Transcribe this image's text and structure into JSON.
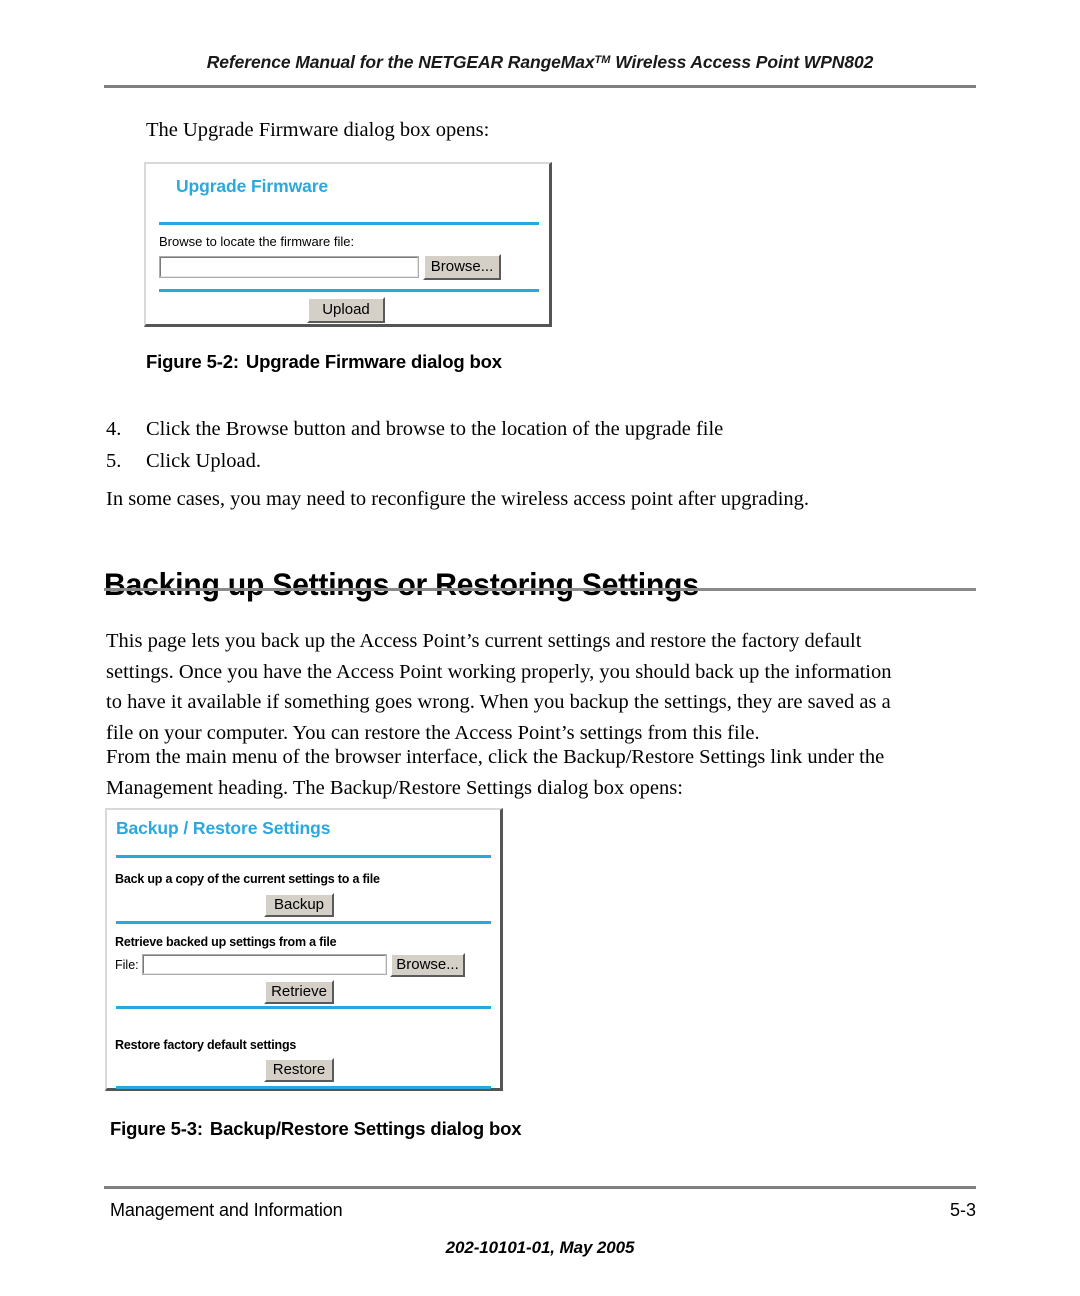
{
  "header": {
    "running_title_pre": "Reference Manual for the NETGEAR RangeMax",
    "trademark": "TM",
    "running_title_post": " Wireless Access Point WPN802"
  },
  "intro": {
    "line": "The Upgrade Firmware dialog box opens:"
  },
  "upgrade_dialog": {
    "title": "Upgrade Firmware",
    "browse_label": "Browse to locate the firmware file:",
    "file_value": "",
    "browse_button": "Browse...",
    "upload_button": "Upload"
  },
  "figure_2": {
    "number": "Figure 5-2:",
    "caption": "Upgrade Firmware dialog box"
  },
  "steps": [
    {
      "num": "4.",
      "text": "Click the Browse button and browse to the location of the upgrade file"
    },
    {
      "num": "5.",
      "text": "Click Upload."
    }
  ],
  "post_steps_paragraph": "In some cases, you may need to reconfigure the wireless access point after upgrading.",
  "section": {
    "heading": "Backing up Settings or Restoring Settings",
    "paragraph_1": "This page lets you back up the Access Point’s current settings and restore the factory default settings. Once you have the Access Point working properly, you should back up the information to have it available if something goes wrong. When you backup the settings, they are saved as a file on your computer. You can restore the Access Point’s settings from this file.",
    "paragraph_2": "From the main menu of the browser interface, click the Backup/Restore Settings link under the Management heading. The Backup/Restore Settings dialog box opens:"
  },
  "backup_dialog": {
    "title": "Backup / Restore Settings",
    "backup_section_label": "Back up a copy of the current settings to a file",
    "backup_button": "Backup",
    "retrieve_section_label": "Retrieve backed up settings from a file",
    "file_label": "File:",
    "file_value": "",
    "browse_button": "Browse...",
    "retrieve_button": "Retrieve",
    "restore_section_label": "Restore factory default settings",
    "restore_button": "Restore"
  },
  "figure_3": {
    "number": "Figure 5-3:",
    "caption": "Backup/Restore Settings dialog box"
  },
  "footer": {
    "left": "Management and Information",
    "right": "5-3",
    "center": "202-10101-01, May 2005"
  },
  "colors": {
    "netgear_blue": "#29a8dc",
    "rule_gray": "#808080",
    "button_face": "#d4d0c8"
  }
}
